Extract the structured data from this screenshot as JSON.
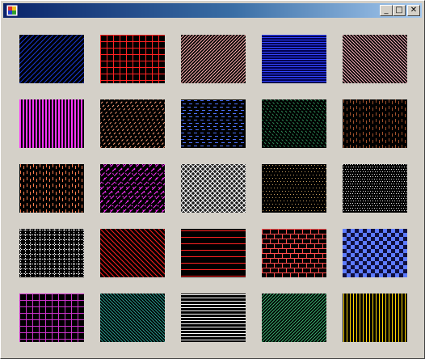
{
  "window": {
    "title": "",
    "controls": {
      "minimize": "_",
      "maximize": "□",
      "close": "✕"
    }
  },
  "patterns": [
    {
      "style": "diag-fwd",
      "fg": "#1a3bd6",
      "bg": "#000000"
    },
    {
      "style": "grid",
      "fg": "#ff2222",
      "bg": "#000000"
    },
    {
      "style": "diag-fwd-dense",
      "fg": "#ffb0b0",
      "bg": "#000000"
    },
    {
      "style": "horizontal-dense",
      "fg": "#3344ff",
      "bg": "#000050"
    },
    {
      "style": "diag-back-dense",
      "fg": "#ffb6c1",
      "bg": "#000000"
    },
    {
      "style": "vertical-wide",
      "fg": "#ff33ff",
      "bg": "#000000"
    },
    {
      "style": "dashed-diag",
      "fg": "#ffa07a",
      "bg": "#000000"
    },
    {
      "style": "dashed-horizontal",
      "fg": "#4f74ff",
      "bg": "#000000"
    },
    {
      "style": "dashed-diag-back",
      "fg": "#2e8b57",
      "bg": "#000000"
    },
    {
      "style": "dashed-vertical",
      "fg": "#a0522d",
      "bg": "#000000"
    },
    {
      "style": "dashed-vertical",
      "fg": "#ff7f50",
      "bg": "#000000"
    },
    {
      "style": "weave",
      "fg": "#ff33ff",
      "bg": "#000000"
    },
    {
      "style": "diag-cross",
      "fg": "#ffffff",
      "bg": "#1a1a1a"
    },
    {
      "style": "dots",
      "fg": "#c8a060",
      "bg": "#000000"
    },
    {
      "style": "dots-dense",
      "fg": "#e0e0e0",
      "bg": "#000000"
    },
    {
      "style": "dotted-grid",
      "fg": "#ffffff",
      "bg": "#000000"
    },
    {
      "style": "diag-back",
      "fg": "#ff2222",
      "bg": "#000000"
    },
    {
      "style": "horizontal-wide",
      "fg": "#ff2222",
      "bg": "#000000"
    },
    {
      "style": "brick",
      "fg": "#ff4d4d",
      "bg": "#000000"
    },
    {
      "style": "checker",
      "fg": "#5d7bff",
      "bg": "#101040"
    },
    {
      "style": "grid",
      "fg": "#cc33cc",
      "bg": "#000000"
    },
    {
      "style": "diag-back-dense",
      "fg": "#2a9d8f",
      "bg": "#000000"
    },
    {
      "style": "horizontal",
      "fg": "#ffffff",
      "bg": "#000000"
    },
    {
      "style": "diag-fwd-dense",
      "fg": "#3cb371",
      "bg": "#000000"
    },
    {
      "style": "vertical",
      "fg": "#ffd700",
      "bg": "#000000"
    }
  ]
}
